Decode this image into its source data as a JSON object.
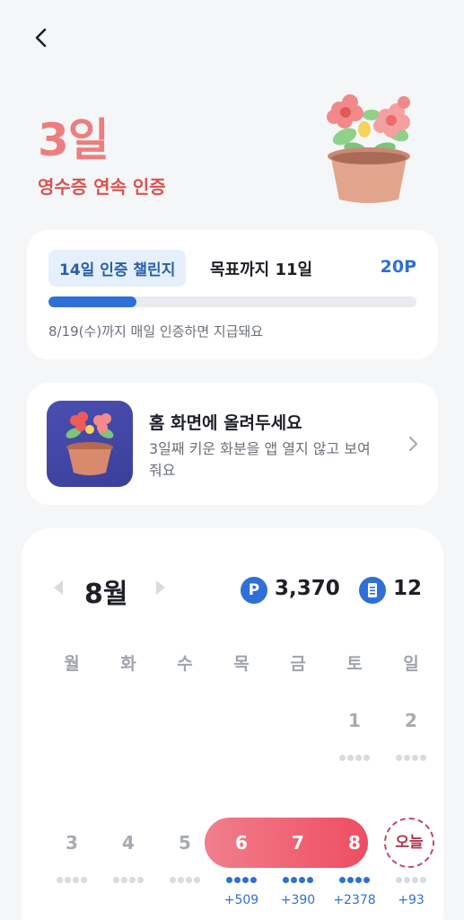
{
  "header": {
    "back_icon": "chevron-left-icon"
  },
  "streak": {
    "count": "3일",
    "label": "영수증 연속 인증",
    "illustration_icon": "flower-pot-icon"
  },
  "challenge": {
    "chip_label": "14일 인증 챌린지",
    "goal_text": "목표까지 11일",
    "reward": "20P",
    "progress": 0.24,
    "note": "8/19(수)까지 매일 인증하면 지급돼요"
  },
  "widget_promo": {
    "title": "홈 화면에 올려두세요",
    "description": "3일째 키운 화분을 앱 열지 않고 보여줘요",
    "chevron_icon": "chevron-right-icon"
  },
  "calendar": {
    "month": "8월",
    "points_icon_letter": "P",
    "points": "3,370",
    "receipts": "12",
    "weekdays": [
      "월",
      "화",
      "수",
      "목",
      "금",
      "토",
      "일"
    ],
    "week1": [
      {
        "day": "1",
        "bonus": ""
      },
      {
        "day": "2",
        "bonus": ""
      }
    ],
    "week2": [
      {
        "day": "3",
        "bonus": ""
      },
      {
        "day": "4",
        "bonus": ""
      },
      {
        "day": "5",
        "bonus": ""
      },
      {
        "day": "6",
        "bonus": "+509"
      },
      {
        "day": "7",
        "bonus": "+390"
      },
      {
        "day": "8",
        "bonus": "+2378"
      },
      {
        "day": "오늘",
        "bonus": "+93"
      }
    ]
  },
  "colors": {
    "accent_blue": "#2f6fd6",
    "streak_red": "#d9534f",
    "streak_pink": "#ec7e7e",
    "pill_start": "#f17f8c",
    "pill_end": "#ee4d62"
  }
}
